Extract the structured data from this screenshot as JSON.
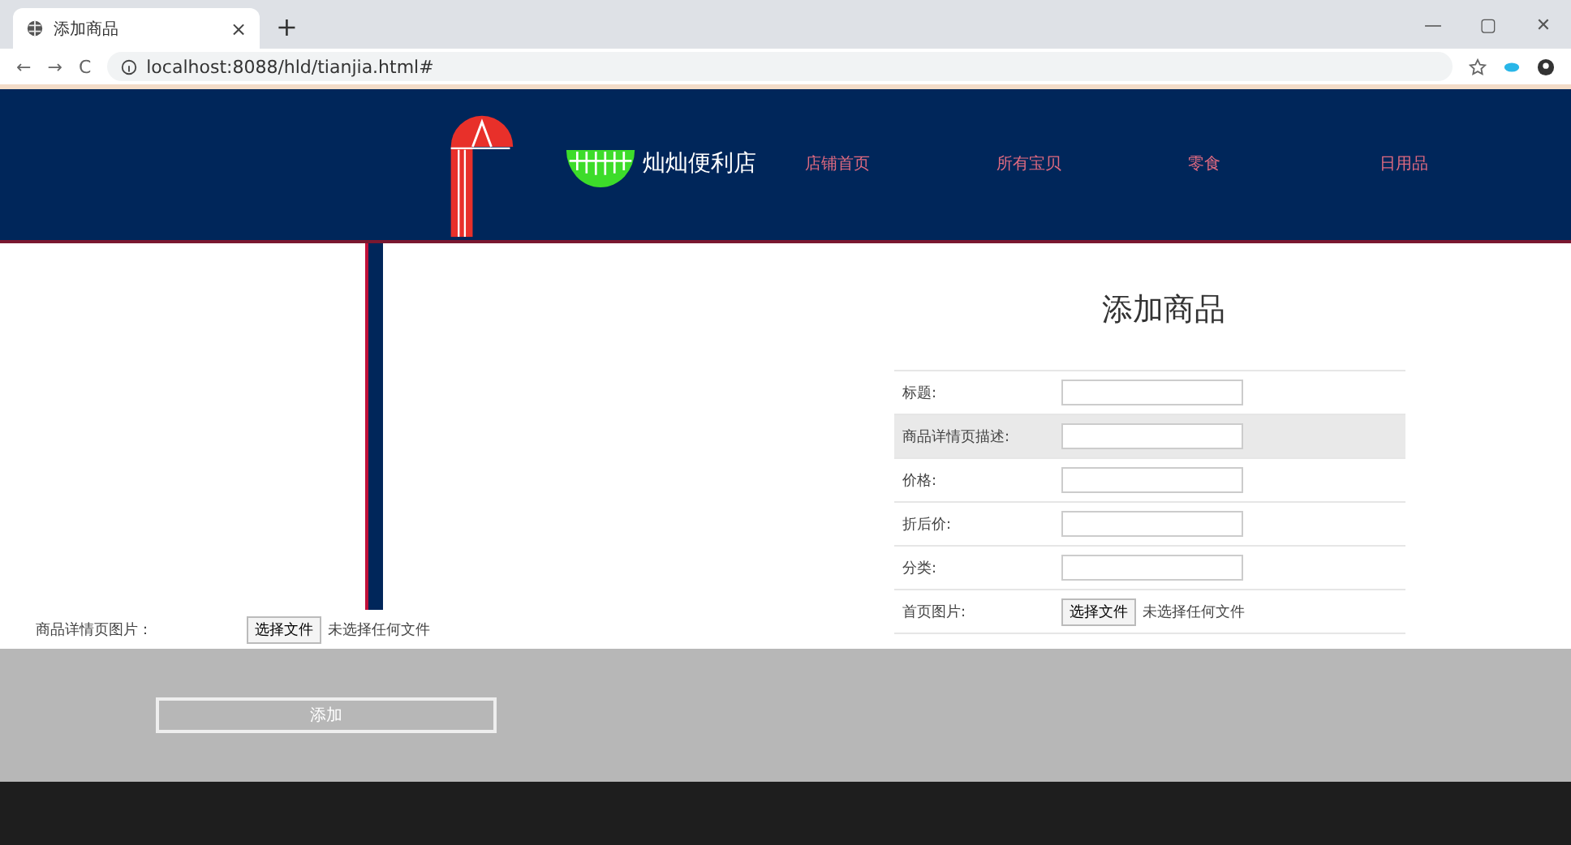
{
  "browser": {
    "tab_title": "添加商品",
    "tab_close": "×",
    "new_tab": "+",
    "url": "localhost:8088/hld/tianjia.html#",
    "nav_back": "←",
    "nav_forward": "→",
    "reload": "C",
    "minimize": "—",
    "maximize": "▢",
    "close": "✕"
  },
  "header": {
    "shop_name": "灿灿便利店",
    "nav": [
      {
        "label": "店铺首页"
      },
      {
        "label": "所有宝贝"
      },
      {
        "label": "零食"
      },
      {
        "label": "日用品"
      }
    ]
  },
  "form": {
    "title": "添加商品",
    "rows": [
      {
        "kind": "text",
        "label": "标题:",
        "shaded": false
      },
      {
        "kind": "text",
        "label": "商品详情页描述:",
        "shaded": true
      },
      {
        "kind": "text",
        "label": "价格:",
        "shaded": false
      },
      {
        "kind": "text",
        "label": "折后价:",
        "shaded": false
      },
      {
        "kind": "text",
        "label": "分类:",
        "shaded": false
      },
      {
        "kind": "file",
        "label": "首页图片:",
        "shaded": false,
        "button": "选择文件",
        "status": "未选择任何文件"
      }
    ],
    "detail_row": {
      "label": "商品详情页图片：",
      "button": "选择文件",
      "status": "未选择任何文件"
    },
    "submit": "添加"
  }
}
